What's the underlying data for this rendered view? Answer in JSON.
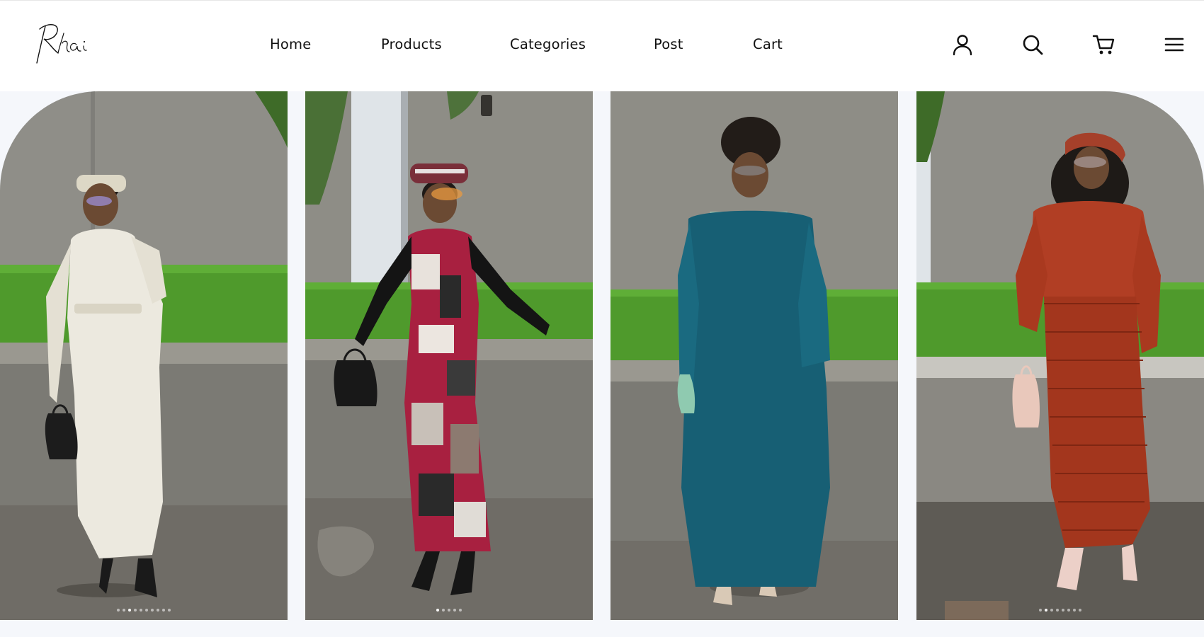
{
  "brand": {
    "logo_text": "Rhai"
  },
  "nav": {
    "items": [
      {
        "label": "Home"
      },
      {
        "label": "Products"
      },
      {
        "label": "Categories"
      },
      {
        "label": "Post"
      },
      {
        "label": "Cart"
      }
    ]
  },
  "header_icons": [
    "user-icon",
    "search-icon",
    "cart-icon",
    "menu-icon"
  ],
  "colors": {
    "background": "#ffffff",
    "gallery_bg": "#f5f7fb",
    "text": "#111111",
    "wall": "#8e8d86",
    "grass": "#4f9a2c",
    "pavement": "#6f6c66"
  },
  "gallery": {
    "cards": [
      {
        "outfit": "cream-textured-dress",
        "carousel_dots": 10,
        "active_dot": 2
      },
      {
        "outfit": "patchwork-print-dress",
        "carousel_dots": 5,
        "active_dot": 0
      },
      {
        "outfit": "teal-collared-dress",
        "carousel_dots": 0,
        "active_dot": 0
      },
      {
        "outfit": "rust-textured-set",
        "carousel_dots": 8,
        "active_dot": 1
      }
    ]
  }
}
